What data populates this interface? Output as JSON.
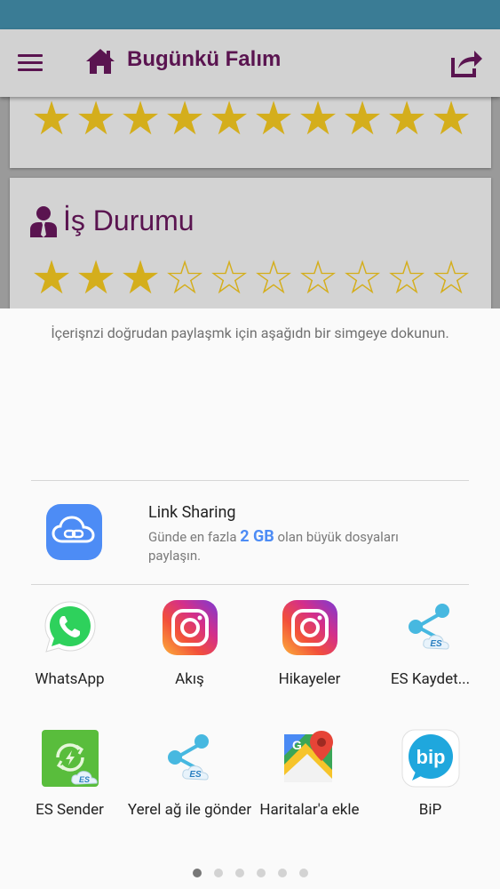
{
  "appbar": {
    "title": "Bugünkü Falım"
  },
  "cards": [
    {
      "title": "",
      "rating": 10,
      "max": 10
    },
    {
      "title": "İş Durumu",
      "rating": 3,
      "max": 10
    }
  ],
  "share_sheet": {
    "hint": "İçerişnzi doğrudan paylaşmk için aşağıdn bir simgeye dokunun.",
    "link_sharing": {
      "title": "Link Sharing",
      "desc_prefix": "Günde en fazla",
      "desc_size": "2 GB",
      "desc_suffix": "olan büyük dosyaları paylaşın."
    },
    "apps": [
      {
        "label": "WhatsApp",
        "icon": "whatsapp-icon"
      },
      {
        "label": "Akış",
        "icon": "instagram-icon"
      },
      {
        "label": "Hikayeler",
        "icon": "instagram-icon"
      },
      {
        "label": "ES Kaydet...",
        "icon": "es-share-icon"
      },
      {
        "label": "ES Sender",
        "icon": "es-sender-icon"
      },
      {
        "label": "Yerel ağ ile gönder",
        "icon": "es-share-icon"
      },
      {
        "label": "Haritalar'a ekle",
        "icon": "google-maps-icon"
      },
      {
        "label": "BiP",
        "icon": "bip-icon"
      }
    ],
    "page_count": 6,
    "active_page": 1
  },
  "colors": {
    "statusbar": "#3a7c95",
    "brand": "#5a1450",
    "star": "#d4ae1c",
    "link_accent": "#4d8cf5"
  }
}
